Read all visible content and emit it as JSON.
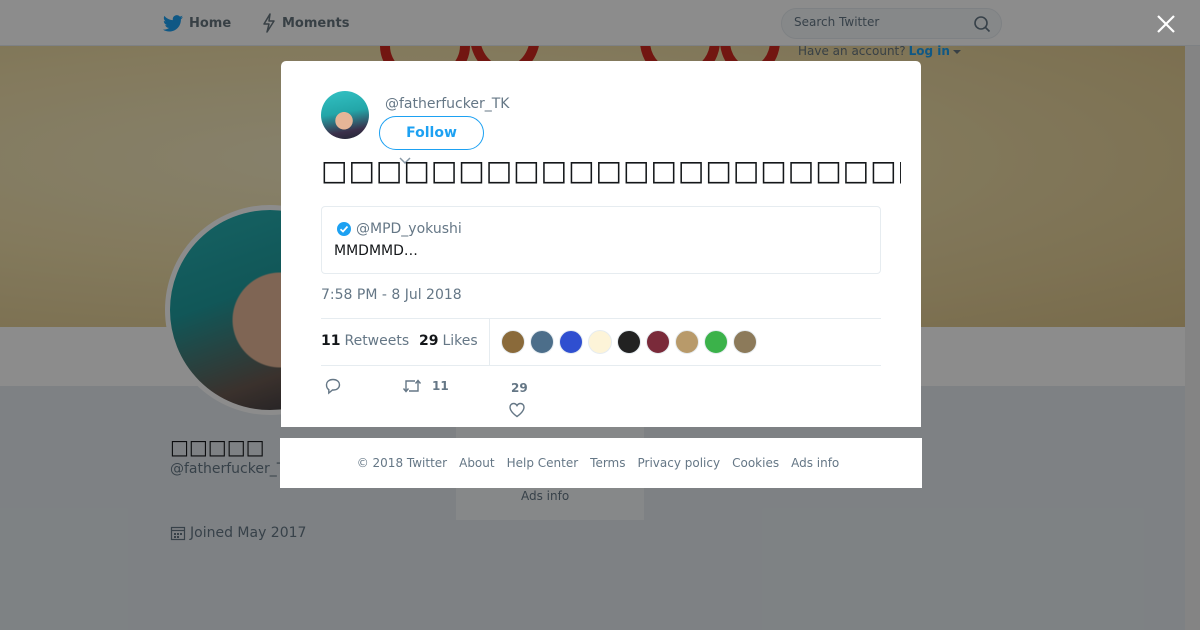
{
  "nav": {
    "home_label": "Home",
    "moments_label": "Moments",
    "search_placeholder": "Search Twitter",
    "have_account_text": "Have an account?",
    "login_label": "Log in"
  },
  "profile": {
    "name": "□□□□□",
    "handle": "@fatherfucker_TK",
    "joined": "Joined May 2017",
    "side_link": "Ads info"
  },
  "tweet": {
    "handle": "@fatherfucker_TK",
    "follow_label": "Follow",
    "text": "□□□□□□□□□□□□□□□□□□□□□□□□□□□□□□",
    "quote": {
      "handle": "@MPD_yokushi",
      "text": "MMDMMD…"
    },
    "timestamp": "7:58 PM - 8 Jul 2018",
    "retweets_count": "11",
    "retweets_label": "Retweets",
    "likes_count": "29",
    "likes_label": "Likes",
    "liker_colors": [
      "#8a6a3a",
      "#4c6e8a",
      "#2f4fd0",
      "#fdf4d8",
      "#222222",
      "#7a2a3a",
      "#b89a6a",
      "#3bb24a",
      "#8c7a5a"
    ],
    "action_retweet_count": "11",
    "action_like_count": "29"
  },
  "footer": {
    "copyright": "© 2018 Twitter",
    "links": [
      "About",
      "Help Center",
      "Terms",
      "Privacy policy",
      "Cookies",
      "Ads info"
    ]
  },
  "colors": {
    "accent": "#1da1f2",
    "muted": "#657786",
    "overlay": "rgba(0,0,0,0.45)"
  }
}
